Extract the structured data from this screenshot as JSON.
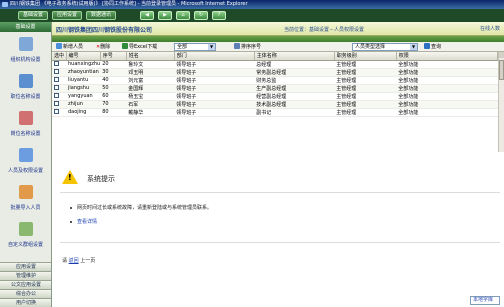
{
  "window": {
    "title": "四川钢铁集团 《电子政务系统(试用版)》 [协同工作系统] - 当前登录管理员 - Microsoft Internet Explorer"
  },
  "topbar": {
    "buttons": [
      "基础设置",
      "应用设置",
      "数据通讯"
    ]
  },
  "sidebar": {
    "header": "基础设置",
    "items": [
      {
        "label": "组织机构设置",
        "icon": "org-icon",
        "color": "#7fa7d8"
      },
      {
        "label": "职位名称设置",
        "icon": "position-icon",
        "color": "#5b8fd0"
      },
      {
        "label": "岗位名称设置",
        "icon": "post-icon",
        "color": "#d07070"
      },
      {
        "label": "人员及权限设置",
        "icon": "people-icon",
        "color": "#6b9de0"
      },
      {
        "label": "批量导入人员",
        "icon": "import-icon",
        "color": "#e09a4a"
      },
      {
        "label": "自定义群组设置",
        "icon": "group-icon",
        "color": "#8ab86f"
      }
    ],
    "bottom": [
      "应用设置",
      "管理维护",
      "公文应用设置",
      "综合办公",
      "用户切换"
    ]
  },
  "main": {
    "company": "四川钢铁集团四川钢铁股份有限公司",
    "location": "当前位置：基础设置－人员权限设置",
    "online": "在线人数"
  },
  "toolbar": {
    "new": "新增人员",
    "delete": "删除",
    "export": "导Excel下载",
    "filter_value": "全部",
    "sort_label": "排序序号",
    "search_value": "人员类型选择",
    "search_btn": "查询"
  },
  "table": {
    "headers": [
      "选中",
      "编号",
      "序号",
      "姓名",
      "部门",
      "主体名称",
      "职务级别",
      "权限"
    ],
    "rows": [
      {
        "id": "huanxingzhu",
        "seq": "20",
        "name": "鲁玲文",
        "dept": "领导班子",
        "title": "总经理",
        "level": "主管经理",
        "perm": "全部功能"
      },
      {
        "id": "zhaoyuntian",
        "seq": "30",
        "name": "邓玉明",
        "dept": "领导班子",
        "title": "常务副总经理",
        "level": "主管经理",
        "perm": "全部功能"
      },
      {
        "id": "liuyantu",
        "seq": "40",
        "name": "刘元富",
        "dept": "领导班子",
        "title": "财务总监",
        "level": "主管经理",
        "perm": "全部功能"
      },
      {
        "id": "jiangshu",
        "seq": "50",
        "name": "金国辉",
        "dept": "领导班子",
        "title": "生产副总经理",
        "level": "主管经理",
        "perm": "全部功能"
      },
      {
        "id": "yangyuan",
        "seq": "60",
        "name": "杨玉宝",
        "dept": "领导班子",
        "title": "经营副总经理",
        "level": "主管经理",
        "perm": "全部功能"
      },
      {
        "id": "zhijun",
        "seq": "70",
        "name": "石军",
        "dept": "领导班子",
        "title": "技术副总经理",
        "level": "主管经理",
        "perm": "全部功能"
      },
      {
        "id": "daojing",
        "seq": "80",
        "name": "戴静华",
        "dept": "领导班子",
        "title": "副书记",
        "level": "主管经理",
        "perm": "全部功能"
      }
    ]
  },
  "alert": {
    "title": "系统提示",
    "message": "网页时间过长或系统故障，请重新登陆或与系统管理员联系。",
    "link": "查看详情",
    "back_prefix": "请",
    "back_link": "返回",
    "back_suffix": "上一页"
  },
  "status": {
    "label": "本地字库"
  }
}
